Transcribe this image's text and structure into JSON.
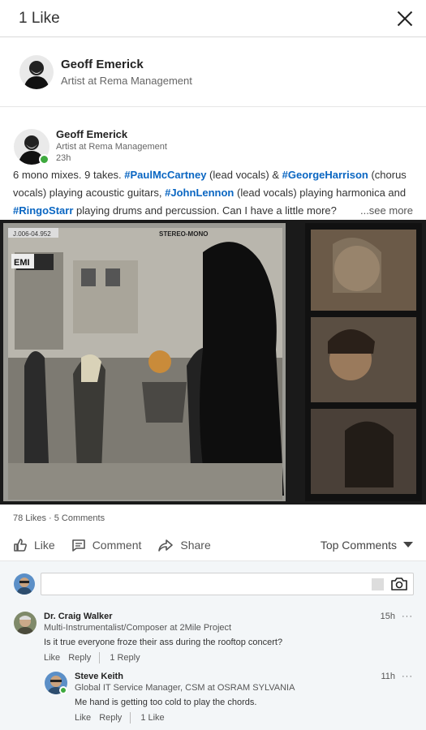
{
  "header": {
    "title": "1 Like"
  },
  "liker": {
    "name": "Geoff Emerick",
    "headline": "Artist at Rema Management"
  },
  "post": {
    "author": "Geoff Emerick",
    "headline": "Artist at Rema Management",
    "time": "23h",
    "text": {
      "p1": "6 mono mixes. 9 takes. ",
      "tag1": "#PaulMcCartney",
      "p2": " (lead vocals) & ",
      "tag2": "#GeorgeHarrison",
      "p3": " (chorus vocals) playing acoustic guitars, ",
      "tag3": "#JohnLennon",
      "p4": " (lead vocals) playing harmonica and ",
      "tag4": "#RingoStarr",
      "p5": " playing drums and percussion. Can I have a little more?",
      "see_more": "...see more"
    },
    "image": {
      "label_left": "J.006-04.952",
      "label_mid": "STEREO-MONO",
      "label_emi": "EMI"
    },
    "social_counts": "78 Likes · 5 Comments",
    "actions": {
      "like": "Like",
      "comment": "Comment",
      "share": "Share"
    },
    "sort": "Top Comments"
  },
  "comments": [
    {
      "author": "Dr. Craig Walker",
      "headline": "Multi-Instrumentalist/Composer at 2Mile Project",
      "time": "15h",
      "more": "···",
      "text": "Is it true everyone froze their ass during the rooftop concert?",
      "like": "Like",
      "reply": "Reply",
      "reply_count": "1 Reply"
    },
    {
      "author": "Steve Keith",
      "headline": "Global IT Service Manager, CSM at OSRAM SYLVANIA",
      "time": "11h",
      "more": "···",
      "text": "Me hand is getting too cold to play the chords.",
      "like": "Like",
      "reply": "Reply",
      "like_count": "1 Like"
    }
  ],
  "colors": {
    "hashtag": "#0a66c2",
    "online": "#3ea93e",
    "comments_bg": "#f3f6f8"
  }
}
